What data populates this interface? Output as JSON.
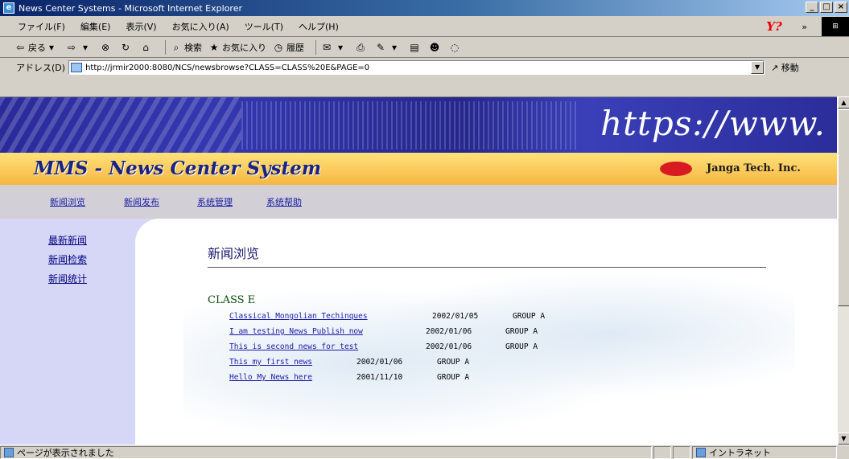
{
  "window": {
    "title": "News Center Systems - Microsoft Internet Explorer",
    "controls": [
      "_",
      "□",
      "×"
    ]
  },
  "menu": {
    "items": [
      "ファイル(F)",
      "編集(E)",
      "表示(V)",
      "お気に入り(A)",
      "ツール(T)",
      "ヘルプ(H)"
    ],
    "yahoo_label": "Y?",
    "chevron": "»"
  },
  "toolbar": {
    "back": "戻る",
    "search": "検索",
    "favorites": "お気に入り",
    "history": "履歴"
  },
  "address": {
    "label": "アドレス(D)",
    "url": "http://jrmir2000:8080/NCS/newsbrowse?CLASS=CLASS%20E&PAGE=0",
    "go": "移動"
  },
  "page": {
    "banner_text": "https://www.",
    "system_name": "MMS - News Center System",
    "company": "Janga Tech. Inc.",
    "nav": [
      "新闻浏览",
      "新闻发布",
      "系统管理",
      "系统帮助"
    ],
    "side": [
      "最新新闻",
      "新闻检索",
      "新闻统计"
    ],
    "section_title": "新闻浏览",
    "class_name": "CLASS E",
    "news": [
      {
        "title": "Classical Mongolian Techinques",
        "date": "2002/01/05",
        "group": "GROUP A"
      },
      {
        "title": "I am testing News Publish now",
        "date": "2002/01/06",
        "group": "GROUP A"
      },
      {
        "title": "This is second news for test",
        "date": "2002/01/06",
        "group": "GROUP A"
      },
      {
        "title": "This my first news",
        "date": "2002/01/06",
        "group": "GROUP A"
      },
      {
        "title": "Hello My News here",
        "date": "2001/11/10",
        "group": "GROUP A"
      }
    ]
  },
  "status": {
    "message": "ページが表示されました",
    "zone": "イントラネット"
  }
}
